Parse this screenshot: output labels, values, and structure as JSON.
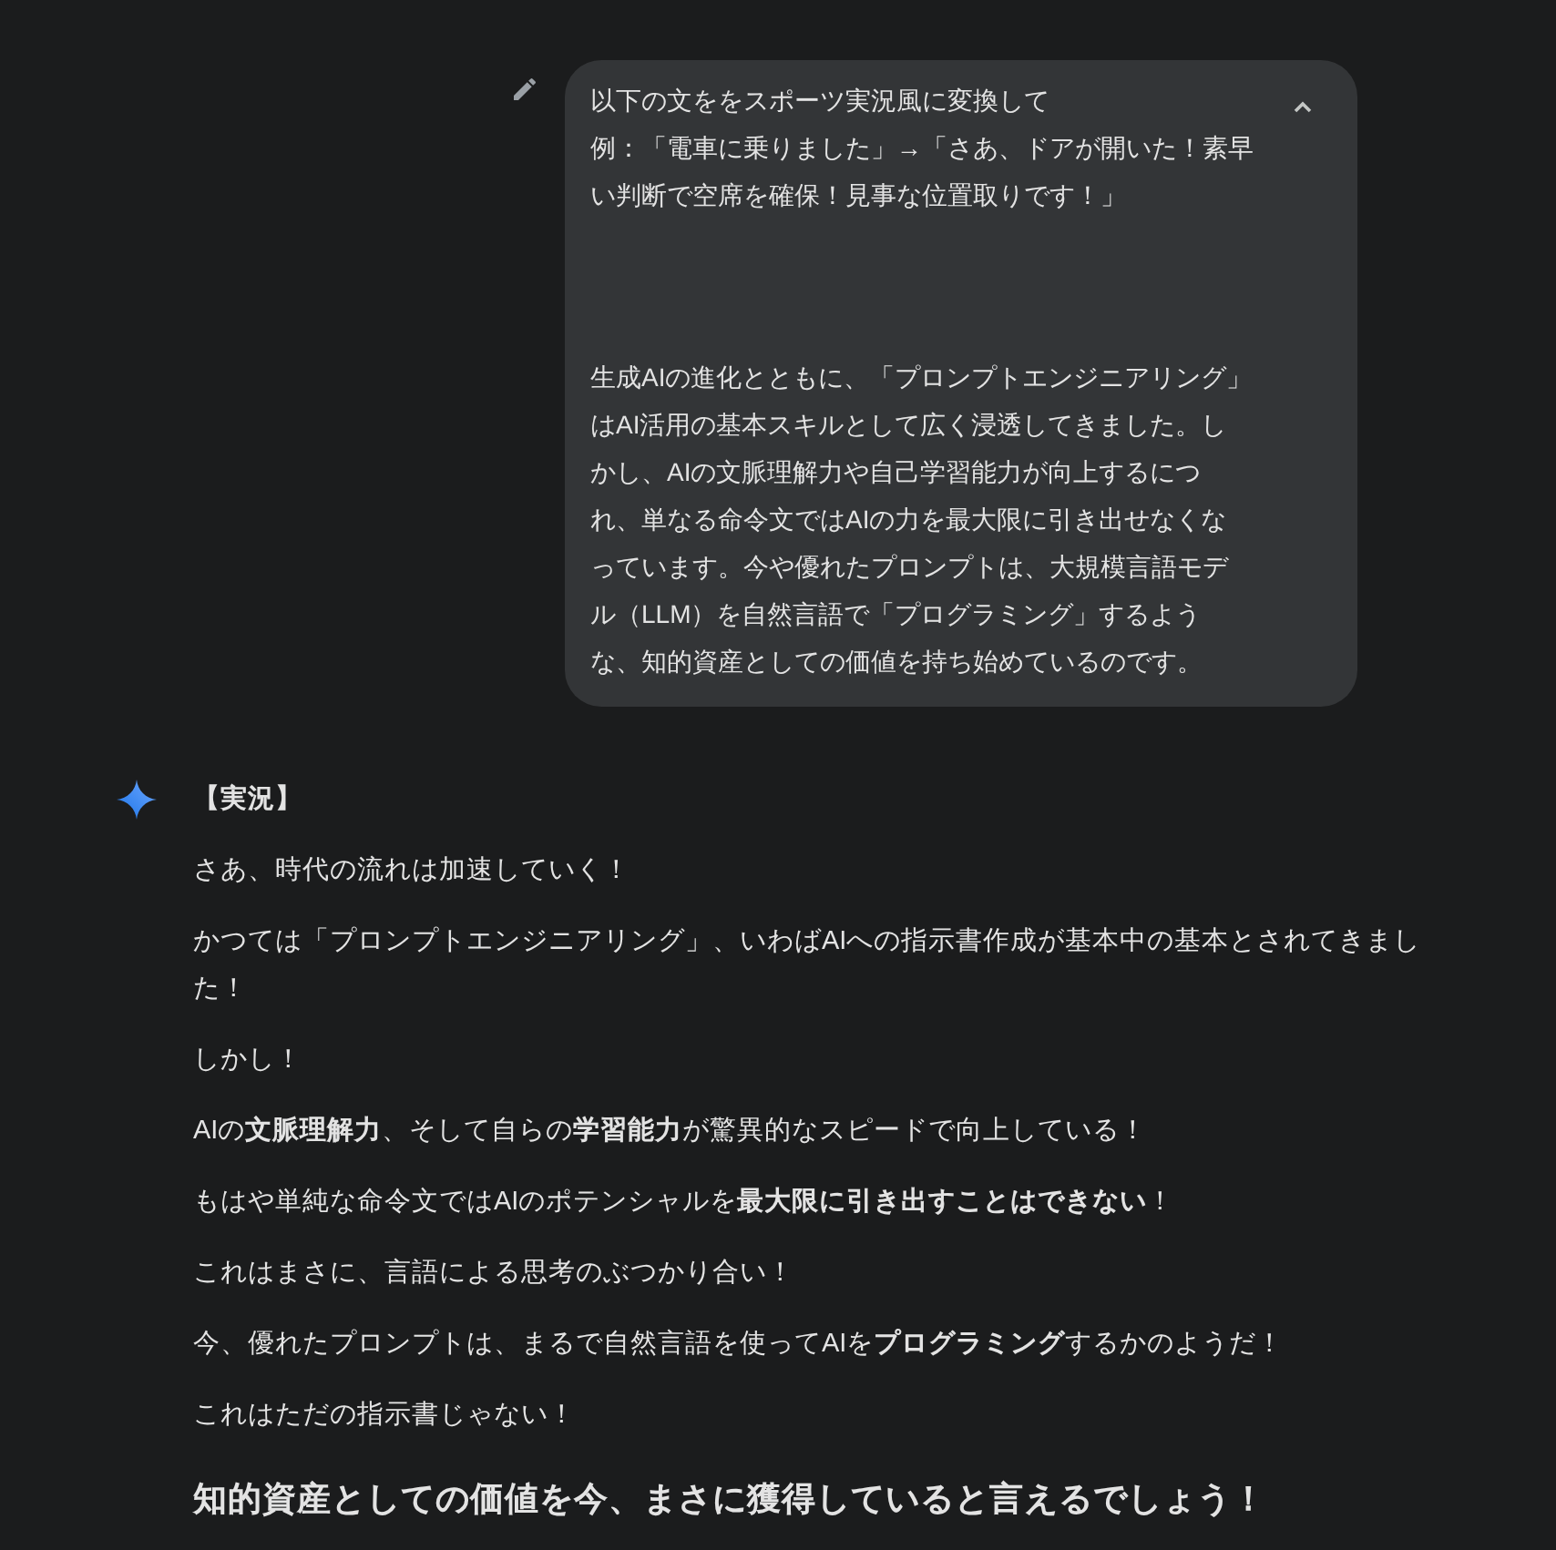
{
  "prompt": {
    "expanded": true,
    "paragraphs": [
      {
        "lines": [
          "以下の文ををスポーツ実況風に変換して",
          "例：「電車に乗りました」→「さあ、ドアが開いた！素早",
          "い判断で空席を確保！見事な位置取りです！」"
        ]
      },
      {
        "lines": [
          "生成AIの進化とともに、「プロンプトエンジニアリング」",
          "はAI活用の基本スキルとして広く浸透してきました。し",
          "かし、AIの文脈理解力や自己学習能力が向上するにつ",
          "れ、単なる命令文ではAIの力を最大限に引き出せなくな",
          "っています。今や優れたプロンプトは、大規模言語モデ",
          "ル（LLM）を自然言語で「プログラミング」するよう",
          "な、知的資産としての価値を持ち始めているのです。"
        ]
      }
    ]
  },
  "response": {
    "blocks": [
      {
        "kind": "label",
        "text": "【実況】"
      },
      {
        "kind": "paragraph",
        "text": "さあ、時代の流れは加速していく！"
      },
      {
        "kind": "paragraph",
        "text": "かつては「プロンプトエンジニアリング」、いわばAIへの指示書作成が基本中の基本とされてきました！"
      },
      {
        "kind": "paragraph",
        "text": "しかし！"
      },
      {
        "kind": "paragraph",
        "text": "AIの**文脈理解力**、そして自らの**学習能力**が驚異的なスピードで向上している！"
      },
      {
        "kind": "paragraph",
        "text": "もはや単純な命令文ではAIのポテンシャルを**最大限に引き出すことはできない**！"
      },
      {
        "kind": "paragraph",
        "text": "これはまさに、言語による思考のぶつかり合い！"
      },
      {
        "kind": "paragraph",
        "text": "今、優れたプロンプトは、まるで自然言語を使ってAIを**プログラミング**するかのようだ！"
      },
      {
        "kind": "paragraph",
        "text": "これはただの指示書じゃない！"
      },
      {
        "kind": "heading",
        "text": "知的資産としての価値を今、まさに獲得していると言えるでしょう！"
      }
    ]
  }
}
